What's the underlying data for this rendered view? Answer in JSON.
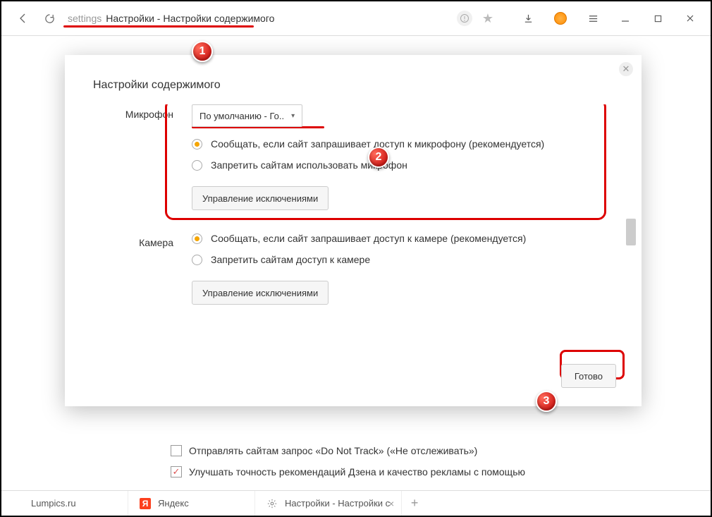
{
  "chrome": {
    "address_prefix": "settings",
    "address_title": "Настройки - Настройки содержимого"
  },
  "modal": {
    "title": "Настройки содержимого",
    "done": "Готово",
    "close": "✕",
    "mic": {
      "label": "Микрофон",
      "dropdown": "По умолчанию - Го..",
      "opt1": "Сообщать, если сайт запрашивает доступ к микрофону (рекомендуется)",
      "opt2": "Запретить сайтам использовать микрофон",
      "exc": "Управление исключениями"
    },
    "cam": {
      "label": "Камера",
      "opt1": "Сообщать, если сайт запрашивает доступ к камере (рекомендуется)",
      "opt2": "Запретить сайтам доступ к камере",
      "exc": "Управление исключениями"
    }
  },
  "bg": {
    "dnt": "Отправлять сайтам запрос «Do Not Track» («Не отслеживать»)",
    "zen": "Улучшать точность рекомендаций Дзена и качество рекламы с помощью"
  },
  "tabs": {
    "t1": "Lumpics.ru",
    "t2": "Яндекс",
    "t3": "Настройки - Настройки с"
  },
  "markers": {
    "m1": "1",
    "m2": "2",
    "m3": "3"
  }
}
